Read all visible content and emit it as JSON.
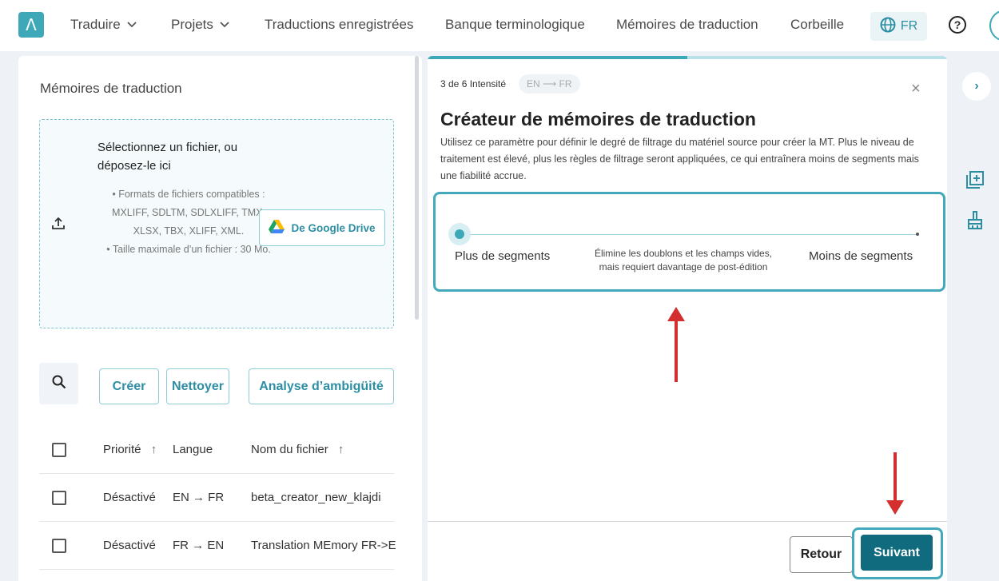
{
  "nav": {
    "logo": "Λ",
    "items": [
      "Traduire",
      "Projets",
      "Traductions enregistrées",
      "Banque terminologique",
      "Mémoires de traduction",
      "Corbeille"
    ],
    "chevron": "⌄",
    "lang": "FR",
    "help": "?"
  },
  "left": {
    "title": "Mémoires de traduction",
    "dropzone": {
      "title": "Sélectionnez un fichier, ou déposez-le ici",
      "formats": "Formats de fichiers compatibles : MXLIFF, SDLTM, SDLXLIFF, TMX, XLSX, TBX, XLIFF, XML.",
      "max_size": "Taille maximale d’un fichier : 30 Mo.",
      "gdrive_label": "De Google Drive"
    },
    "buttons": {
      "create": "Créer",
      "clean": "Nettoyer",
      "ambiguity": "Analyse d’ambigüité"
    },
    "table": {
      "headers": {
        "priority": "Priorité",
        "language": "Langue",
        "filename": "Nom du fichier",
        "sort": "↑"
      },
      "rows": [
        {
          "priority": "Désactivé",
          "language": "EN → FR",
          "filename": "beta_creator_new_klajdi"
        },
        {
          "priority": "Désactivé",
          "language": "FR → EN",
          "filename": "Translation MEmory FR->E"
        }
      ]
    }
  },
  "wizard": {
    "step": "3 de 6 Intensité",
    "lang_pair": "EN ⟶ FR",
    "close": "×",
    "title": "Créateur de mémoires de traduction",
    "description": "Utilisez ce paramètre pour définir le degré de filtrage du matériel source pour créer la MT. Plus le niveau de traitement est élevé, plus les règles de filtrage seront appliquées, ce qui entraînera moins de segments mais une fiabilité accrue.",
    "progress": 0.5,
    "slider": {
      "left_label": "Plus de segments",
      "middle_label": "Élimine les doublons et les champs vides, mais requiert davantage de post-édition",
      "right_label": "Moins de segments",
      "value": 0
    },
    "back": "Retour",
    "next": "Suivant"
  },
  "rail": {
    "toggle": "›"
  },
  "colors": {
    "accent": "#3da8b8",
    "primary_dark": "#116b7e",
    "annotation": "#d32f2f"
  }
}
